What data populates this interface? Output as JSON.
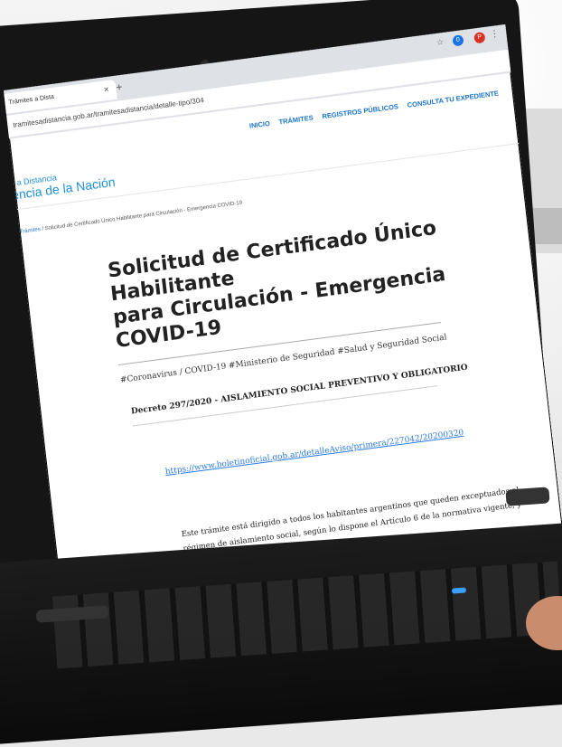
{
  "browser": {
    "tab_title": "Trámites a Dista",
    "tab_close": "×",
    "new_tab": "+",
    "url": "tramitesadistancia.gob.ar/tramitesadistancia/detalle-tipo/304",
    "star_icon": "☆",
    "ext1": "0",
    "ext2": "P",
    "more_icon": "⋮"
  },
  "site": {
    "brand_line1": "s a Distancia",
    "brand_line2": "encia de la Nación",
    "nav": [
      "INICIO",
      "TRÁMITES",
      "REGISTROS PÚBLICOS",
      "CONSULTA TU EXPEDIENTE"
    ]
  },
  "breadcrumb": {
    "root": "Trámites",
    "sep": " / ",
    "current": "Solicitud de Certificado Único Habilitante para Circulación - Emergencia COVID-19"
  },
  "page": {
    "title_line1": "Solicitud de Certificado Único Habilitante",
    "title_line2": "para Circulación - Emergencia COVID-19",
    "tags": "#Coronavirus / COVID-19 #Ministerio de Seguridad #Salud y Seguridad Social",
    "decree": "Decreto 297/2020 - AISLAMIENTO SOCIAL PREVENTIVO Y OBLIGATORIO",
    "link": "https://www.boletinoficial.gob.ar/detalleAviso/primera/227042/20200320",
    "paragraph": "Este trámite está dirigido a todos los habitantes argentinos que queden exceptuados al régimen de aislamiento social, según lo dispone el Artículo 6 de la normativa vigente, y no dispongan de una"
  }
}
